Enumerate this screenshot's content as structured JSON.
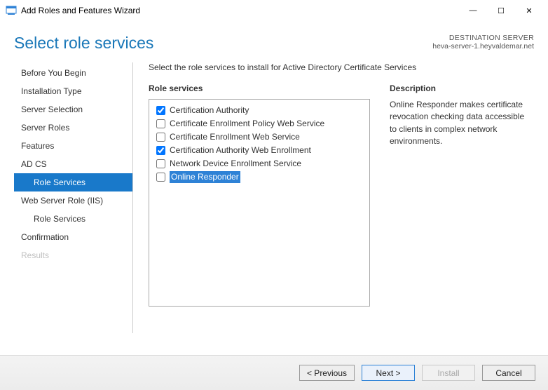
{
  "window": {
    "title": "Add Roles and Features Wizard"
  },
  "header": {
    "page_title": "Select role services",
    "destination_label": "DESTINATION SERVER",
    "destination_host": "heva-server-1.heyvaldemar.net"
  },
  "sidebar": {
    "items": [
      {
        "label": "Before You Begin",
        "selected": false,
        "sub": false,
        "disabled": false
      },
      {
        "label": "Installation Type",
        "selected": false,
        "sub": false,
        "disabled": false
      },
      {
        "label": "Server Selection",
        "selected": false,
        "sub": false,
        "disabled": false
      },
      {
        "label": "Server Roles",
        "selected": false,
        "sub": false,
        "disabled": false
      },
      {
        "label": "Features",
        "selected": false,
        "sub": false,
        "disabled": false
      },
      {
        "label": "AD CS",
        "selected": false,
        "sub": false,
        "disabled": false
      },
      {
        "label": "Role Services",
        "selected": true,
        "sub": true,
        "disabled": false
      },
      {
        "label": "Web Server Role (IIS)",
        "selected": false,
        "sub": false,
        "disabled": false
      },
      {
        "label": "Role Services",
        "selected": false,
        "sub": true,
        "disabled": false
      },
      {
        "label": "Confirmation",
        "selected": false,
        "sub": false,
        "disabled": false
      },
      {
        "label": "Results",
        "selected": false,
        "sub": false,
        "disabled": true
      }
    ]
  },
  "main": {
    "instruction": "Select the role services to install for Active Directory Certificate Services",
    "roles_header": "Role services",
    "description_header": "Description",
    "description_text": "Online Responder makes certificate revocation checking data accessible to clients in complex network environments.",
    "services": [
      {
        "label": "Certification Authority",
        "checked": true,
        "highlighted": false
      },
      {
        "label": "Certificate Enrollment Policy Web Service",
        "checked": false,
        "highlighted": false
      },
      {
        "label": "Certificate Enrollment Web Service",
        "checked": false,
        "highlighted": false
      },
      {
        "label": "Certification Authority Web Enrollment",
        "checked": true,
        "highlighted": false
      },
      {
        "label": "Network Device Enrollment Service",
        "checked": false,
        "highlighted": false
      },
      {
        "label": "Online Responder",
        "checked": false,
        "highlighted": true
      }
    ]
  },
  "buttons": {
    "previous": "< Previous",
    "next": "Next >",
    "install": "Install",
    "cancel": "Cancel"
  }
}
